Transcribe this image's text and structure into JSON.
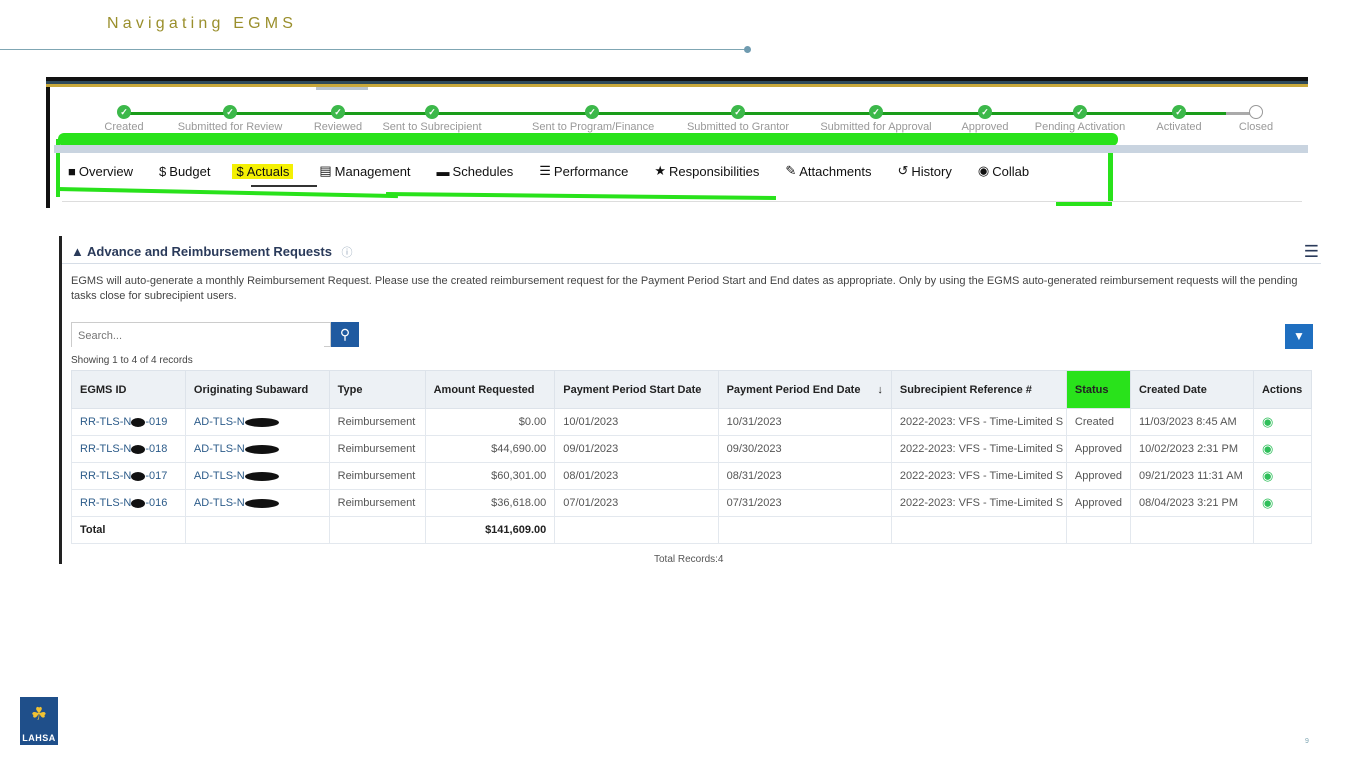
{
  "slide": {
    "title": "Navigating EGMS",
    "page_number": "9"
  },
  "logo": {
    "text": "LAHSA"
  },
  "progress": {
    "steps": [
      {
        "label": "Created",
        "done": true
      },
      {
        "label": "Submitted for Review",
        "done": true
      },
      {
        "label": "Reviewed",
        "done": true
      },
      {
        "label": "Sent to Subrecipient",
        "done": true
      },
      {
        "label": "Sent to Program/Finance",
        "done": true
      },
      {
        "label": "Submitted to Grantor",
        "done": true
      },
      {
        "label": "Submitted for Approval",
        "done": true
      },
      {
        "label": "Approved",
        "done": true
      },
      {
        "label": "Pending Activation",
        "done": true
      },
      {
        "label": "Activated",
        "done": true
      },
      {
        "label": "Closed",
        "done": false
      }
    ]
  },
  "tabs": [
    {
      "label": "Overview",
      "icon": "book-icon"
    },
    {
      "label": "Budget",
      "icon": "dollar-icon"
    },
    {
      "label": "Actuals",
      "icon": "dollar-icon",
      "active": true
    },
    {
      "label": "Management",
      "icon": "file-icon"
    },
    {
      "label": "Schedules",
      "icon": "folder-icon"
    },
    {
      "label": "Performance",
      "icon": "list-icon"
    },
    {
      "label": "Responsibilities",
      "icon": "star-icon"
    },
    {
      "label": "Attachments",
      "icon": "paperclip-icon"
    },
    {
      "label": "History",
      "icon": "history-icon"
    },
    {
      "label": "Collab",
      "icon": "chat-icon"
    }
  ],
  "section": {
    "title": "Advance and Reimbursement Requests",
    "description": "EGMS will auto-generate a monthly Reimbursement Request.  Please use the created reimbursement request for the Payment Period Start and End dates as appropriate.  Only by using the EGMS auto-generated reimbursement requests will the pending tasks close for subrecipient users.",
    "search_placeholder": "Search...",
    "showing": "Showing 1 to 4 of 4 records",
    "total_records": "Total Records:4"
  },
  "table": {
    "headers": [
      "EGMS ID",
      "Originating Subaward",
      "Type",
      "Amount Requested",
      "Payment Period Start Date",
      "Payment Period End Date",
      "Subrecipient Reference #",
      "Status",
      "Created Date",
      "Actions"
    ],
    "rows": [
      {
        "id_prefix": "RR-TLS-N",
        "id_suffix": "-019",
        "subaward": "AD-TLS-N",
        "type": "Reimbursement",
        "amount": "$0.00",
        "start": "10/01/2023",
        "end": "10/31/2023",
        "ref": "2022-2023: VFS - Time-Limited S",
        "status": "Created",
        "created": "11/03/2023 8:45 AM"
      },
      {
        "id_prefix": "RR-TLS-N",
        "id_suffix": "-018",
        "subaward": "AD-TLS-N",
        "type": "Reimbursement",
        "amount": "$44,690.00",
        "start": "09/01/2023",
        "end": "09/30/2023",
        "ref": "2022-2023: VFS - Time-Limited S",
        "status": "Approved",
        "created": "10/02/2023 2:31 PM"
      },
      {
        "id_prefix": "RR-TLS-N",
        "id_suffix": "-017",
        "subaward": "AD-TLS-N",
        "type": "Reimbursement",
        "amount": "$60,301.00",
        "start": "08/01/2023",
        "end": "08/31/2023",
        "ref": "2022-2023: VFS - Time-Limited S",
        "status": "Approved",
        "created": "09/21/2023 11:31 AM"
      },
      {
        "id_prefix": "RR-TLS-N",
        "id_suffix": "-016",
        "subaward": "AD-TLS-N",
        "type": "Reimbursement",
        "amount": "$36,618.00",
        "start": "07/01/2023",
        "end": "07/31/2023",
        "ref": "2022-2023: VFS - Time-Limited S",
        "status": "Approved",
        "created": "08/04/2023 3:21 PM"
      }
    ],
    "total_label": "Total",
    "total_amount": "$141,609.00"
  },
  "colors": {
    "highlight_green": "#29e21b",
    "highlight_yellow": "#f4f003",
    "accent_blue": "#1f5aa0",
    "progress_green": "#1a9c1a"
  }
}
